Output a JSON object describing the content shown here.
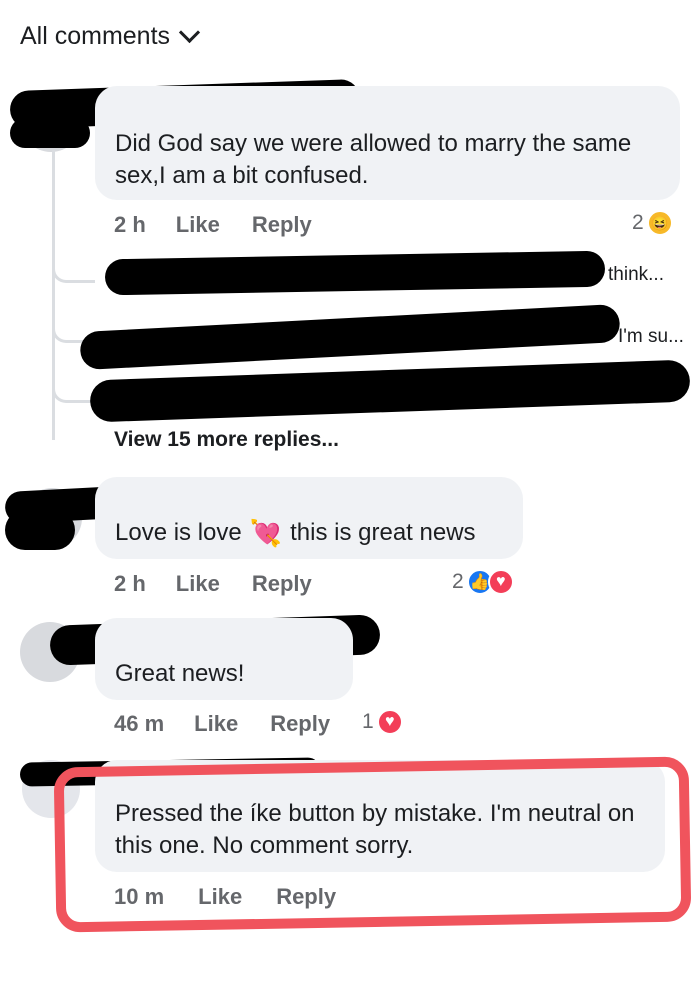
{
  "header": {
    "title": "All comments"
  },
  "comments": [
    {
      "text": "Did God say we were allowed to marry the same sex,I am a bit confused.",
      "time": "2 h",
      "like_label": "Like",
      "reply_label": "Reply",
      "reaction_count": "2",
      "reaction_icons": [
        "haha-emoji"
      ]
    },
    {
      "text": "Love is love",
      "text_after": "this is great news",
      "inline_emoji": "heart-with-arrow",
      "time": "2 h",
      "like_label": "Like",
      "reply_label": "Reply",
      "reaction_count": "2",
      "reaction_icons": [
        "like-emoji",
        "love-emoji"
      ]
    },
    {
      "text": "Great news!",
      "time": "46 m",
      "like_label": "Like",
      "reply_label": "Reply",
      "reaction_count": "1",
      "reaction_icons": [
        "love-emoji"
      ]
    },
    {
      "text": "Pressed the íke button by mistake. I'm neutral on this one. No comment sorry.",
      "time": "10 m",
      "like_label": "Like",
      "reply_label": "Reply"
    }
  ],
  "replies": [
    {
      "visible_text": "think..."
    },
    {
      "visible_text": "I'm su..."
    }
  ],
  "view_more": "View 15 more replies...",
  "colors": {
    "highlight": "#f0545d",
    "bubble": "#f0f2f5",
    "meta": "#65676b",
    "like_blue": "#1877f2",
    "love_red": "#f33e58",
    "haha_yellow": "#f7b928"
  }
}
